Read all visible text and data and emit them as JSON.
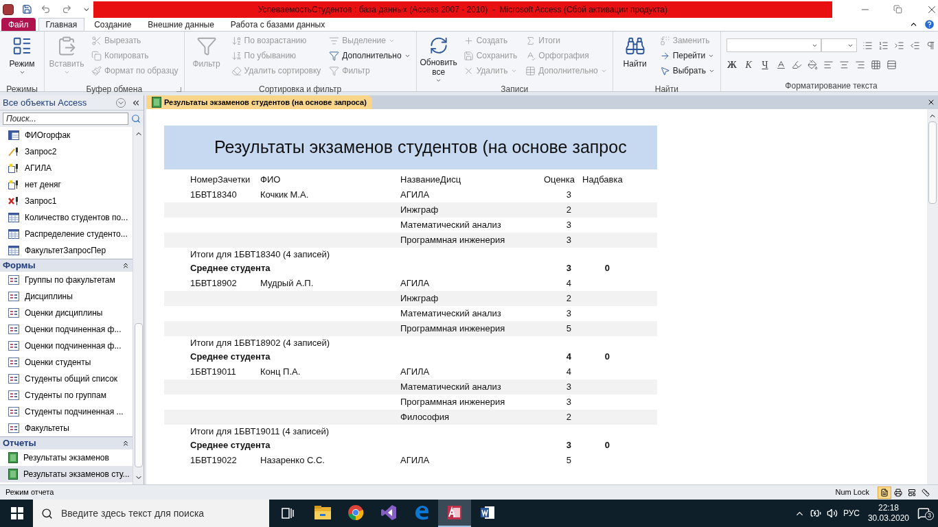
{
  "title_bar": {
    "title": "УспеваемостьСтудентов : база данных (Access 2007 - 2010)  -  Microsoft Access (Сбой активации продукта)"
  },
  "ribbon_tabs": [
    {
      "label": "Файл",
      "kind": "file",
      "selected": false
    },
    {
      "label": "Главная",
      "kind": "tab",
      "selected": true
    },
    {
      "label": "Создание",
      "kind": "tab",
      "selected": false
    },
    {
      "label": "Внешние данные",
      "kind": "tab",
      "selected": false
    },
    {
      "label": "Работа с базами данных",
      "kind": "tab",
      "selected": false
    }
  ],
  "ribbon_groups": [
    {
      "label": "Режимы",
      "large": [
        {
          "label": "Режим",
          "kind": "view",
          "dropdown": true,
          "disabled": false
        }
      ]
    },
    {
      "label": "Буфер обмена",
      "launcher": true,
      "large": [
        {
          "label": "Вставить",
          "kind": "paste",
          "dropdown": true,
          "disabled": true
        }
      ],
      "columns": [
        [
          {
            "label": "Вырезать",
            "kind": "cut",
            "dropdown": false,
            "disabled": true
          },
          {
            "label": "Копировать",
            "kind": "copy",
            "dropdown": false,
            "disabled": true
          },
          {
            "label": "Формат по образцу",
            "kind": "brush",
            "dropdown": false,
            "disabled": true
          }
        ]
      ]
    },
    {
      "label": "Сортировка и фильтр",
      "large": [
        {
          "label": "Фильтр",
          "kind": "filter",
          "dropdown": false,
          "disabled": true
        }
      ],
      "columns": [
        [
          {
            "label": "По возрастанию",
            "kind": "sort-asc",
            "dropdown": false,
            "disabled": true
          },
          {
            "label": "По убыванию",
            "kind": "sort-desc",
            "dropdown": false,
            "disabled": true
          },
          {
            "label": "Удалить сортировку",
            "kind": "sort-clear",
            "dropdown": false,
            "disabled": true
          }
        ],
        [
          {
            "label": "Выделение",
            "kind": "selection",
            "dropdown": true,
            "disabled": true
          },
          {
            "label": "Дополнительно",
            "kind": "advanced-filter",
            "dropdown": true,
            "disabled": false
          },
          {
            "label": "Фильтр",
            "kind": "toggle-filter",
            "dropdown": false,
            "disabled": true
          }
        ]
      ]
    },
    {
      "label": "Записи",
      "large": [
        {
          "label": "Обновить все",
          "kind": "refresh",
          "dropdown": true,
          "disabled": false
        }
      ],
      "columns": [
        [
          {
            "label": "Создать",
            "kind": "new",
            "dropdown": false,
            "disabled": true
          },
          {
            "label": "Сохранить",
            "kind": "save",
            "dropdown": false,
            "disabled": true
          },
          {
            "label": "Удалить",
            "kind": "delete",
            "dropdown": true,
            "disabled": true
          }
        ],
        [
          {
            "label": "Итоги",
            "kind": "totals",
            "dropdown": false,
            "disabled": true
          },
          {
            "label": "Орфография",
            "kind": "spelling",
            "dropdown": false,
            "disabled": true
          },
          {
            "label": "Дополнительно",
            "kind": "more",
            "dropdown": true,
            "disabled": true
          }
        ]
      ]
    },
    {
      "label": "Найти",
      "large": [
        {
          "label": "Найти",
          "kind": "find",
          "dropdown": false,
          "disabled": false
        }
      ],
      "columns": [
        [
          {
            "label": "Заменить",
            "kind": "replace",
            "dropdown": false,
            "disabled": true
          },
          {
            "label": "Перейти",
            "kind": "goto",
            "dropdown": true,
            "disabled": false
          },
          {
            "label": "Выбрать",
            "kind": "select",
            "dropdown": true,
            "disabled": false
          }
        ]
      ]
    }
  ],
  "text_format": {
    "label": "Форматирование текста",
    "letters": [
      "Ж",
      "К",
      "Ч"
    ]
  },
  "nav": {
    "title": "Все объекты Access",
    "search_placeholder": "Поиск...",
    "sections": [
      {
        "items": [
          {
            "label": "ФИОгорфак",
            "kind": "crosstab",
            "selected": false
          },
          {
            "label": "Запрос2",
            "kind": "update",
            "selected": false
          },
          {
            "label": "АГИЛА",
            "kind": "make",
            "selected": false
          },
          {
            "label": "нет деняг",
            "kind": "make",
            "selected": false
          },
          {
            "label": "Запрос1",
            "kind": "delete",
            "selected": false
          },
          {
            "label": "Количество студентов по...",
            "kind": "query",
            "selected": false
          },
          {
            "label": "Распределение студенто...",
            "kind": "query",
            "selected": false
          },
          {
            "label": "ФакультетЗапросПер",
            "kind": "query",
            "selected": false
          }
        ]
      },
      {
        "title": "Формы",
        "expanded": true,
        "items": [
          {
            "label": "Группы по факультетам",
            "kind": "form",
            "selected": false
          },
          {
            "label": "Дисциплины",
            "kind": "form",
            "selected": false
          },
          {
            "label": "Оценки дисциплины",
            "kind": "form",
            "selected": false
          },
          {
            "label": "Оценки подчиненная ф...",
            "kind": "form",
            "selected": false
          },
          {
            "label": "Оценки подчиненная ф...",
            "kind": "form",
            "selected": false
          },
          {
            "label": "Оценки студенты",
            "kind": "form",
            "selected": false
          },
          {
            "label": "Студенты общий список",
            "kind": "form",
            "selected": false
          },
          {
            "label": "Студенты по группам",
            "kind": "form",
            "selected": false
          },
          {
            "label": "Студенты подчиненная ...",
            "kind": "form",
            "selected": false
          },
          {
            "label": "Факультеты",
            "kind": "form",
            "selected": false
          }
        ]
      },
      {
        "title": "Отчеты",
        "expanded": true,
        "items": [
          {
            "label": "Результаты экзаменов",
            "kind": "report",
            "selected": false
          },
          {
            "label": "Результаты экзаменов сту...",
            "kind": "report",
            "selected": true
          }
        ]
      }
    ]
  },
  "doc_tab": {
    "label": "Результаты экзаменов студентов (на основе запроса)",
    "selected": true
  },
  "report": {
    "title": "Результаты экзаменов студентов (на основе запрос",
    "columns": [
      "НомерЗачетки",
      "ФИО",
      "НазваниеДисц",
      "Оценка",
      "Надбавка"
    ],
    "groups": [
      {
        "id": "1БВТ18340",
        "name": "Кочкик М.А.",
        "rows": [
          {
            "discipline": "АГИЛА",
            "grade": "3"
          },
          {
            "discipline": "Инжграф",
            "grade": "2"
          },
          {
            "discipline": "Математический анализ",
            "grade": "3"
          },
          {
            "discipline": "Программная инженерия",
            "grade": "3"
          }
        ],
        "summary": "Итоги для  1БВТ18340 (4 записей)",
        "avg_label": "Среднее студента",
        "avg_grade": "3",
        "avg_bonus": "0"
      },
      {
        "id": "1БВТ18902",
        "name": "Мудрый А.П.",
        "rows": [
          {
            "discipline": "АГИЛА",
            "grade": "4"
          },
          {
            "discipline": "Инжграф",
            "grade": "2"
          },
          {
            "discipline": "Математический анализ",
            "grade": "3"
          },
          {
            "discipline": "Программная инженерия",
            "grade": "5"
          }
        ],
        "summary": "Итоги для  1БВТ18902 (4 записей)",
        "avg_label": "Среднее студента",
        "avg_grade": "4",
        "avg_bonus": "0"
      },
      {
        "id": "1БВТ19011",
        "name": "Конц П.А.",
        "rows": [
          {
            "discipline": "АГИЛА",
            "grade": "4"
          },
          {
            "discipline": "Математический анализ",
            "grade": "3"
          },
          {
            "discipline": "Программная инженерия",
            "grade": "3"
          },
          {
            "discipline": "Философия",
            "grade": "2"
          }
        ],
        "summary": "Итоги для  1БВТ19011 (4 записей)",
        "avg_label": "Среднее студента",
        "avg_grade": "3",
        "avg_bonus": "0"
      },
      {
        "id": "1БВТ19022",
        "name": "Назаренко С.С.",
        "rows": [
          {
            "discipline": "АГИЛА",
            "grade": "5"
          }
        ]
      }
    ]
  },
  "status_bar": {
    "mode": "Режим отчета",
    "num_lock": "Num Lock",
    "views": [
      {
        "kind": "report",
        "selected": true
      },
      {
        "kind": "print",
        "selected": false
      },
      {
        "kind": "layout",
        "selected": false
      },
      {
        "kind": "design",
        "selected": false
      }
    ]
  },
  "taskbar": {
    "search_placeholder": "Введите здесь текст для поиска",
    "apps": [
      {
        "kind": "explorer",
        "active": false
      },
      {
        "kind": "chrome",
        "active": false
      },
      {
        "kind": "vs",
        "active": false
      },
      {
        "kind": "edge",
        "active": false
      },
      {
        "kind": "access",
        "active": true
      },
      {
        "kind": "word",
        "active": false
      }
    ],
    "language": "РУС",
    "time": "22:18",
    "date": "30.03.2020",
    "notifications": "3"
  }
}
